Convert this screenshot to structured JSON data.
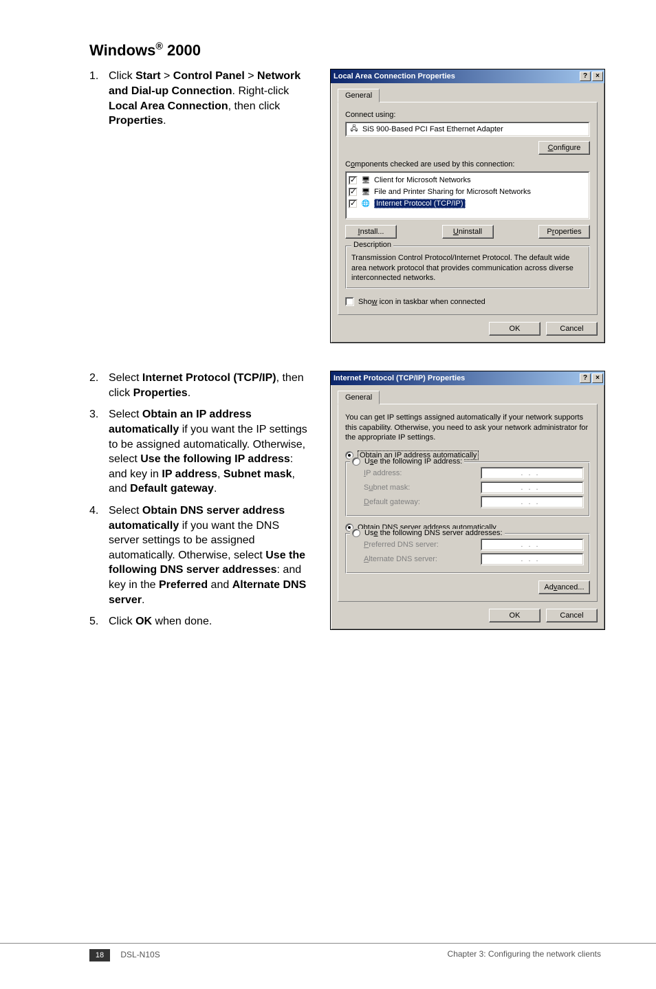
{
  "heading": {
    "pre": "Windows",
    "sup": "®",
    "post": " 2000"
  },
  "section1": {
    "step1": {
      "t1": "Click ",
      "b1": "Start",
      "t2": " > ",
      "b2": "Control Panel",
      "t3": " > ",
      "b3": "Network and Dial-up Connection",
      "t4": ". Right-click ",
      "b4": "Local Area Connection",
      "t5": ", then click ",
      "b5": "Properties",
      "t6": "."
    }
  },
  "section2": {
    "step2": {
      "t1": "Select ",
      "b1": "Internet Protocol (TCP/IP)",
      "t2": ", then click ",
      "b2": "Properties",
      "t3": "."
    },
    "step3": {
      "t1": "Select ",
      "b1": "Obtain an IP address automatically",
      "t2": " if you want the IP settings to be assigned automatically. Otherwise, select ",
      "b2": "Use the following IP address",
      "t3": ": and key in ",
      "b3": "IP address",
      "t4": ", ",
      "b4": "Subnet mask",
      "t5": ", and ",
      "b5": "Default gateway",
      "t6": "."
    },
    "step4": {
      "t1": "Select ",
      "b1": "Obtain DNS server address automatically",
      "t2": " if you want the DNS server settings to be assigned automatically. Otherwise, select ",
      "b2": "Use the following DNS server addresses",
      "t3": ": and key in the ",
      "b3": "Preferred",
      "t4": " and ",
      "b4": "Alternate DNS server",
      "t5": "."
    },
    "step5": {
      "t1": "Click ",
      "b1": "OK",
      "t2": " when done."
    }
  },
  "dlg1": {
    "title": "Local Area Connection Properties",
    "tab": "General",
    "connect_using": "Connect using:",
    "adapter": "SiS 900-Based PCI Fast Ethernet Adapter",
    "configure": "Configure",
    "components_label": "Components checked are used by this connection:",
    "item1": "Client for Microsoft Networks",
    "item2": "File and Printer Sharing for Microsoft Networks",
    "item3": "Internet Protocol (TCP/IP)",
    "install": "Install...",
    "uninstall": "Uninstall",
    "properties": "Properties",
    "description_legend": "Description",
    "description_text": "Transmission Control Protocol/Internet Protocol. The default wide area network protocol that provides communication across diverse interconnected networks.",
    "show_icon": "Show icon in taskbar when connected",
    "ok": "OK",
    "cancel": "Cancel"
  },
  "dlg2": {
    "title": "Internet Protocol (TCP/IP) Properties",
    "tab": "General",
    "intro": "You can get IP settings assigned automatically if your network supports this capability. Otherwise, you need to ask your network administrator for the appropriate IP settings.",
    "opt_auto_ip": "Obtain an IP address automatically",
    "opt_manual_ip": "Use the following IP address:",
    "ip_address": "IP address:",
    "subnet": "Subnet mask:",
    "gateway": "Default gateway:",
    "opt_auto_dns": "Obtain DNS server address automatically",
    "opt_manual_dns": "Use the following DNS server addresses:",
    "pref_dns": "Preferred DNS server:",
    "alt_dns": "Alternate DNS server:",
    "advanced": "Advanced...",
    "ok": "OK",
    "cancel": "Cancel"
  },
  "footer": {
    "page": "18",
    "model": "DSL-N10S",
    "chapter": "Chapter 3: Configuring the network clients"
  }
}
